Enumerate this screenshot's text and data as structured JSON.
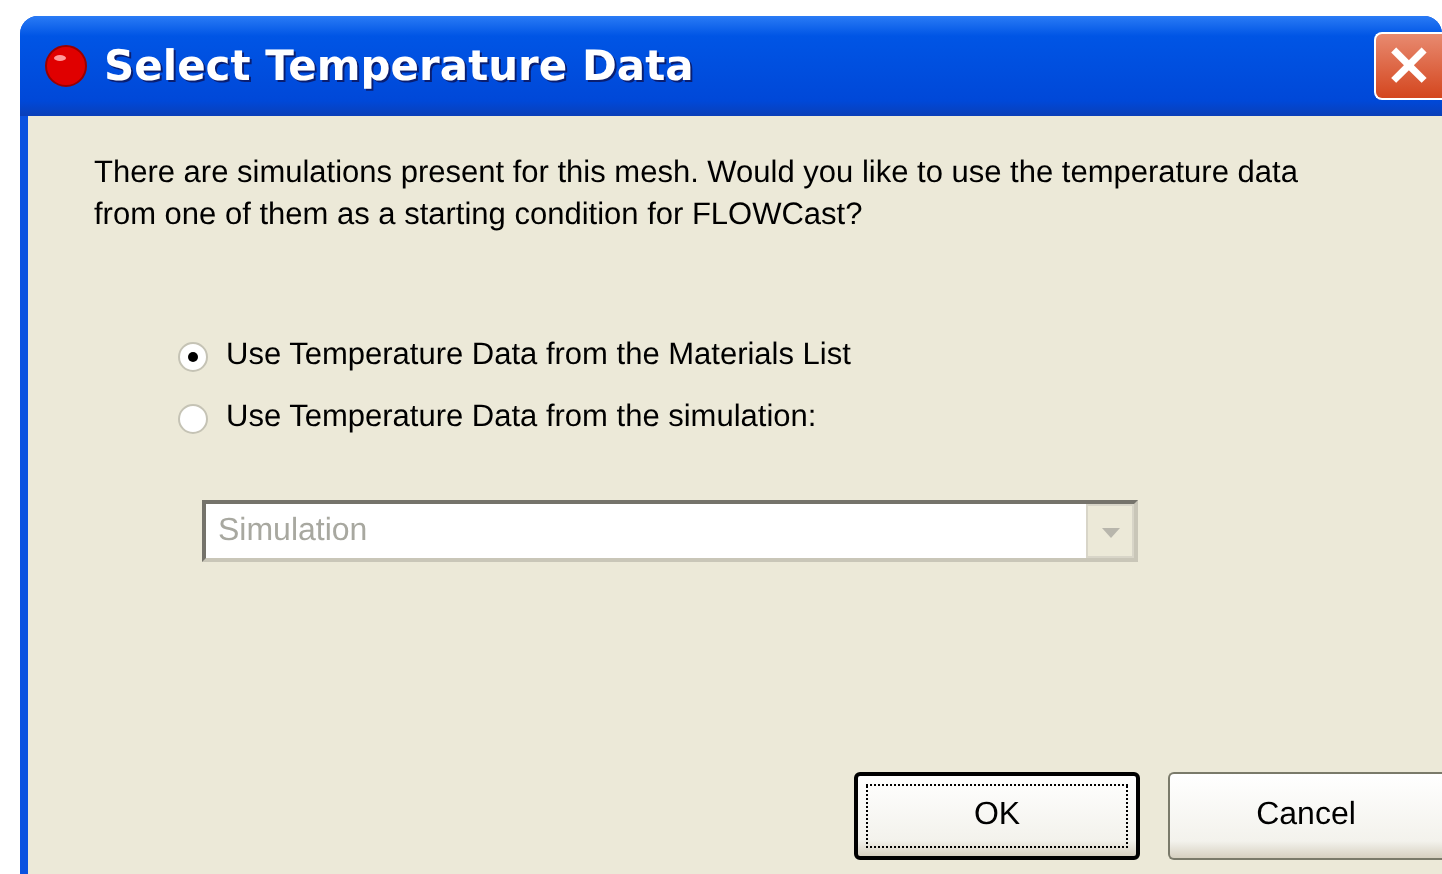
{
  "window": {
    "title": "Select Temperature Data",
    "close_label": "×"
  },
  "message": "There are simulations present for this mesh. Would you like to use the temperature data from one of them as a starting condition for FLOWCast?",
  "options": [
    {
      "label": "Use Temperature Data from the Materials List",
      "selected": true
    },
    {
      "label": "Use Temperature Data from the simulation:",
      "selected": false
    }
  ],
  "dropdown": {
    "value": "Simulation",
    "disabled": true
  },
  "buttons": [
    {
      "label": "OK",
      "focused": true
    },
    {
      "label": "Cancel",
      "focused": false
    }
  ]
}
